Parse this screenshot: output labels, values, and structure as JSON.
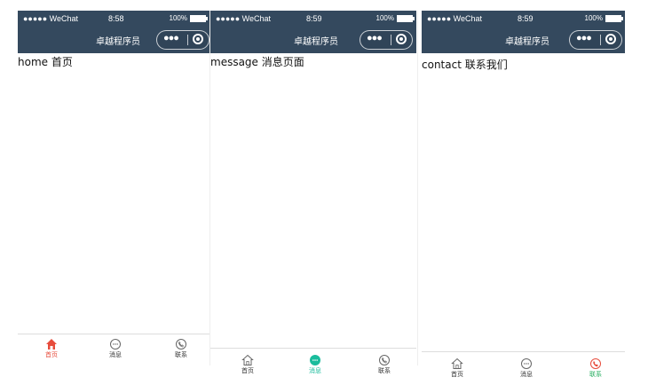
{
  "status_bar": {
    "signal": "●●●●● WeChat",
    "battery": "100%"
  },
  "nav_title": "卓越程序员",
  "screens": [
    {
      "time": "8:58",
      "content": "home 首页",
      "active_tab": "首页"
    },
    {
      "time": "8:59",
      "content": "message 消息页面",
      "active_tab": "消息"
    },
    {
      "time": "8:59",
      "content": "contact 联系我们",
      "active_tab": "联系"
    }
  ],
  "tabs": [
    "首页",
    "消息",
    "联系"
  ],
  "colors": {
    "nav_bg": "#34495e",
    "home_active": "#e74c3c",
    "message_active": "#1abc9c",
    "contact_active": "#e74c3c",
    "tab_inactive": "#333333"
  },
  "icons": {
    "home": "home-icon",
    "message": "chat-bubble-icon",
    "contact": "phone-icon",
    "more": "more-dots-icon",
    "close": "target-icon"
  }
}
